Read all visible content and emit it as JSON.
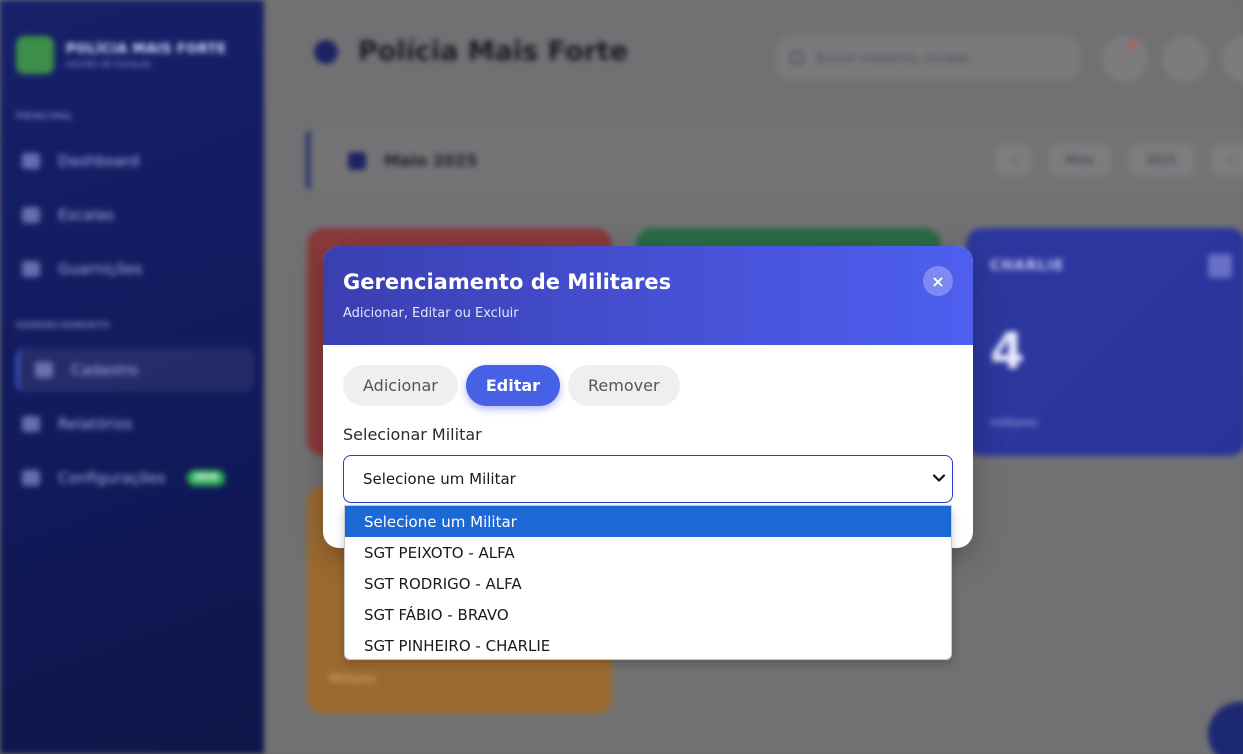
{
  "app": {
    "logo_title": "POLÍCIA MAIS FORTE",
    "logo_subtitle": "GESTÃO DE ESCALAS",
    "sections": {
      "principal": "PRINCIPAL",
      "gerenciamento": "GERENCIAMENTO"
    },
    "sidebar_items": [
      {
        "label": "Dashboard"
      },
      {
        "label": "Escalas"
      },
      {
        "label": "Guarnições"
      },
      {
        "label": "Cadastro"
      },
      {
        "label": "Relatórios"
      },
      {
        "label": "Configurações",
        "badge": "NEW"
      }
    ],
    "header_title": "Polícia Mais Forte",
    "search_placeholder": "Buscar relatórios, escalas...",
    "month_label": "Maio 2025",
    "month_select": "Maio",
    "year_select": "2025",
    "prev": "‹",
    "next": "›",
    "card_blue": {
      "title": "CHARLIE",
      "value": "4",
      "sub": "militares"
    },
    "card_orange": {
      "sub": "Militares"
    }
  },
  "modal": {
    "title": "Gerenciamento de Militares",
    "subtitle": "Adicionar, Editar ou Excluir",
    "close": "×",
    "tabs": [
      {
        "label": "Adicionar",
        "active": false
      },
      {
        "label": "Editar",
        "active": true
      },
      {
        "label": "Remover",
        "active": false
      }
    ],
    "field_label": "Selecionar Militar",
    "select_value": "Selecione um Militar",
    "options": [
      "Selecione um Militar",
      "SGT PEIXOTO - ALFA",
      "SGT RODRIGO - ALFA",
      "SGT FÁBIO - BRAVO",
      "SGT PINHEIRO - CHARLIE"
    ],
    "selected_index": 0
  },
  "colors": {
    "modal_header_start": "#3a3fb0",
    "modal_header_end": "#4e5ff0",
    "tab_active": "#4660e6",
    "option_highlight": "#1c68d4",
    "select_border": "#2a3acb"
  }
}
